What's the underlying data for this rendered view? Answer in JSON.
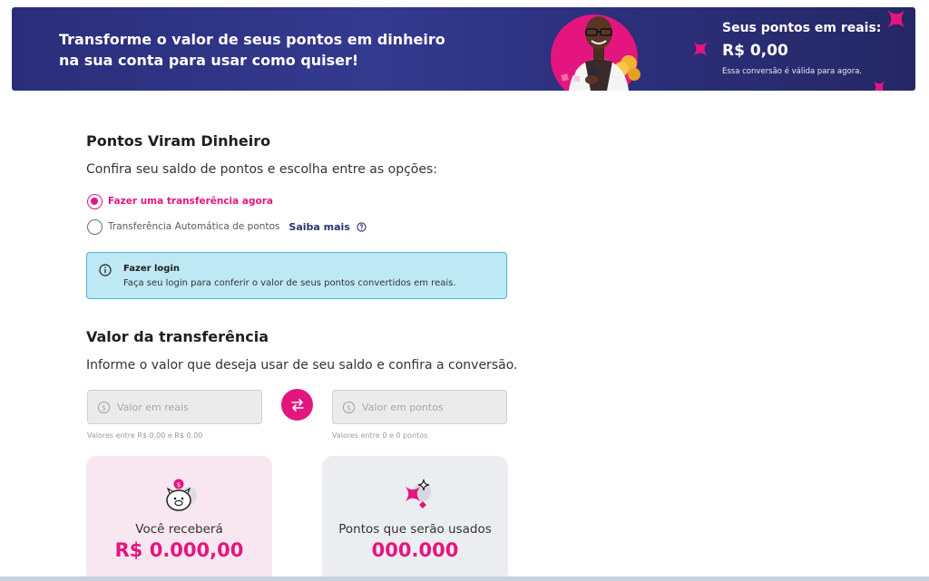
{
  "banner": {
    "headline": "Transforme o valor de seus pontos em dinheiro na sua conta para usar como quiser!",
    "points_title": "Seus pontos em reais:",
    "points_value": "R$ 0,00",
    "points_note": "Essa conversão é válida para agora."
  },
  "section1": {
    "title": "Pontos Viram Dinheiro",
    "subtitle": "Confira seu saldo de pontos e escolha entre as opções:",
    "options": [
      {
        "label": "Fazer uma transferência agora",
        "checked": true
      },
      {
        "label": "Transferência Automática de pontos",
        "checked": false
      }
    ],
    "saiba_mais": "Saiba mais"
  },
  "info": {
    "title": "Fazer login",
    "text": "Faça seu login para conferir o valor de seus pontos convertidos em reais."
  },
  "section2": {
    "title": "Valor da transferência",
    "subtitle": "Informe o valor que deseja usar de seu saldo e confira a conversão."
  },
  "fields": {
    "reais_placeholder": "Valor em reais",
    "reais_hint": "Valores entre R$ 0,00 e R$ 0,00",
    "pontos_placeholder": "Valor em pontos",
    "pontos_hint": "Valores entre 0 e 0 pontos"
  },
  "cards": {
    "receive_label": "Você receberá",
    "receive_value": "R$ 0.000,00",
    "points_label": "Pontos que serão usados",
    "points_value": "000.000"
  },
  "colors": {
    "brand_pink": "#e5157f",
    "banner_navy": "#2d3180",
    "info_bg": "#bfe8f5"
  }
}
